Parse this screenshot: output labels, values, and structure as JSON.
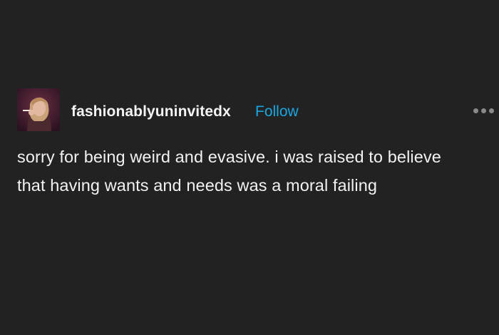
{
  "post": {
    "author": {
      "username": "fashionablyuninvitedx",
      "avatar_icon": "profile-photo"
    },
    "follow_label": "Follow",
    "more_icon": "ellipsis-icon",
    "body_text": "sorry for being weird and evasive. i was raised to believe that having wants and needs was a moral failing"
  },
  "colors": {
    "background": "#222222",
    "text": "#f2f2f2",
    "follow": "#1aa7e0",
    "menu_dots": "#8a8a8a"
  }
}
